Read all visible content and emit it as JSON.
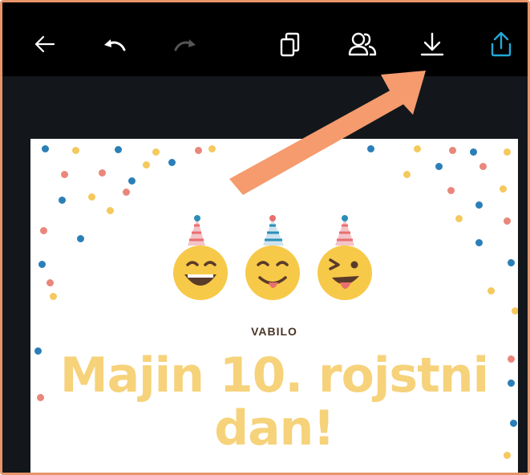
{
  "toolbar": {
    "icons": [
      "back-arrow-icon",
      "undo-icon",
      "redo-icon",
      "pages-icon",
      "share-people-icon",
      "download-icon",
      "upload-share-icon"
    ],
    "upload_color": "#22a8d8",
    "disabled_color": "#555555"
  },
  "design": {
    "eyebrow": "VABILO",
    "title_line1": "Majin 10. rojstni",
    "title_line2": "dan!",
    "title_color": "#f6d27a",
    "eyebrow_color": "#4a3427",
    "confetti_colors": [
      "#2a7fb8",
      "#f4c95d",
      "#e9877a"
    ]
  },
  "annotation": {
    "arrow_color": "#f59b6e",
    "points_to": "download-icon"
  }
}
